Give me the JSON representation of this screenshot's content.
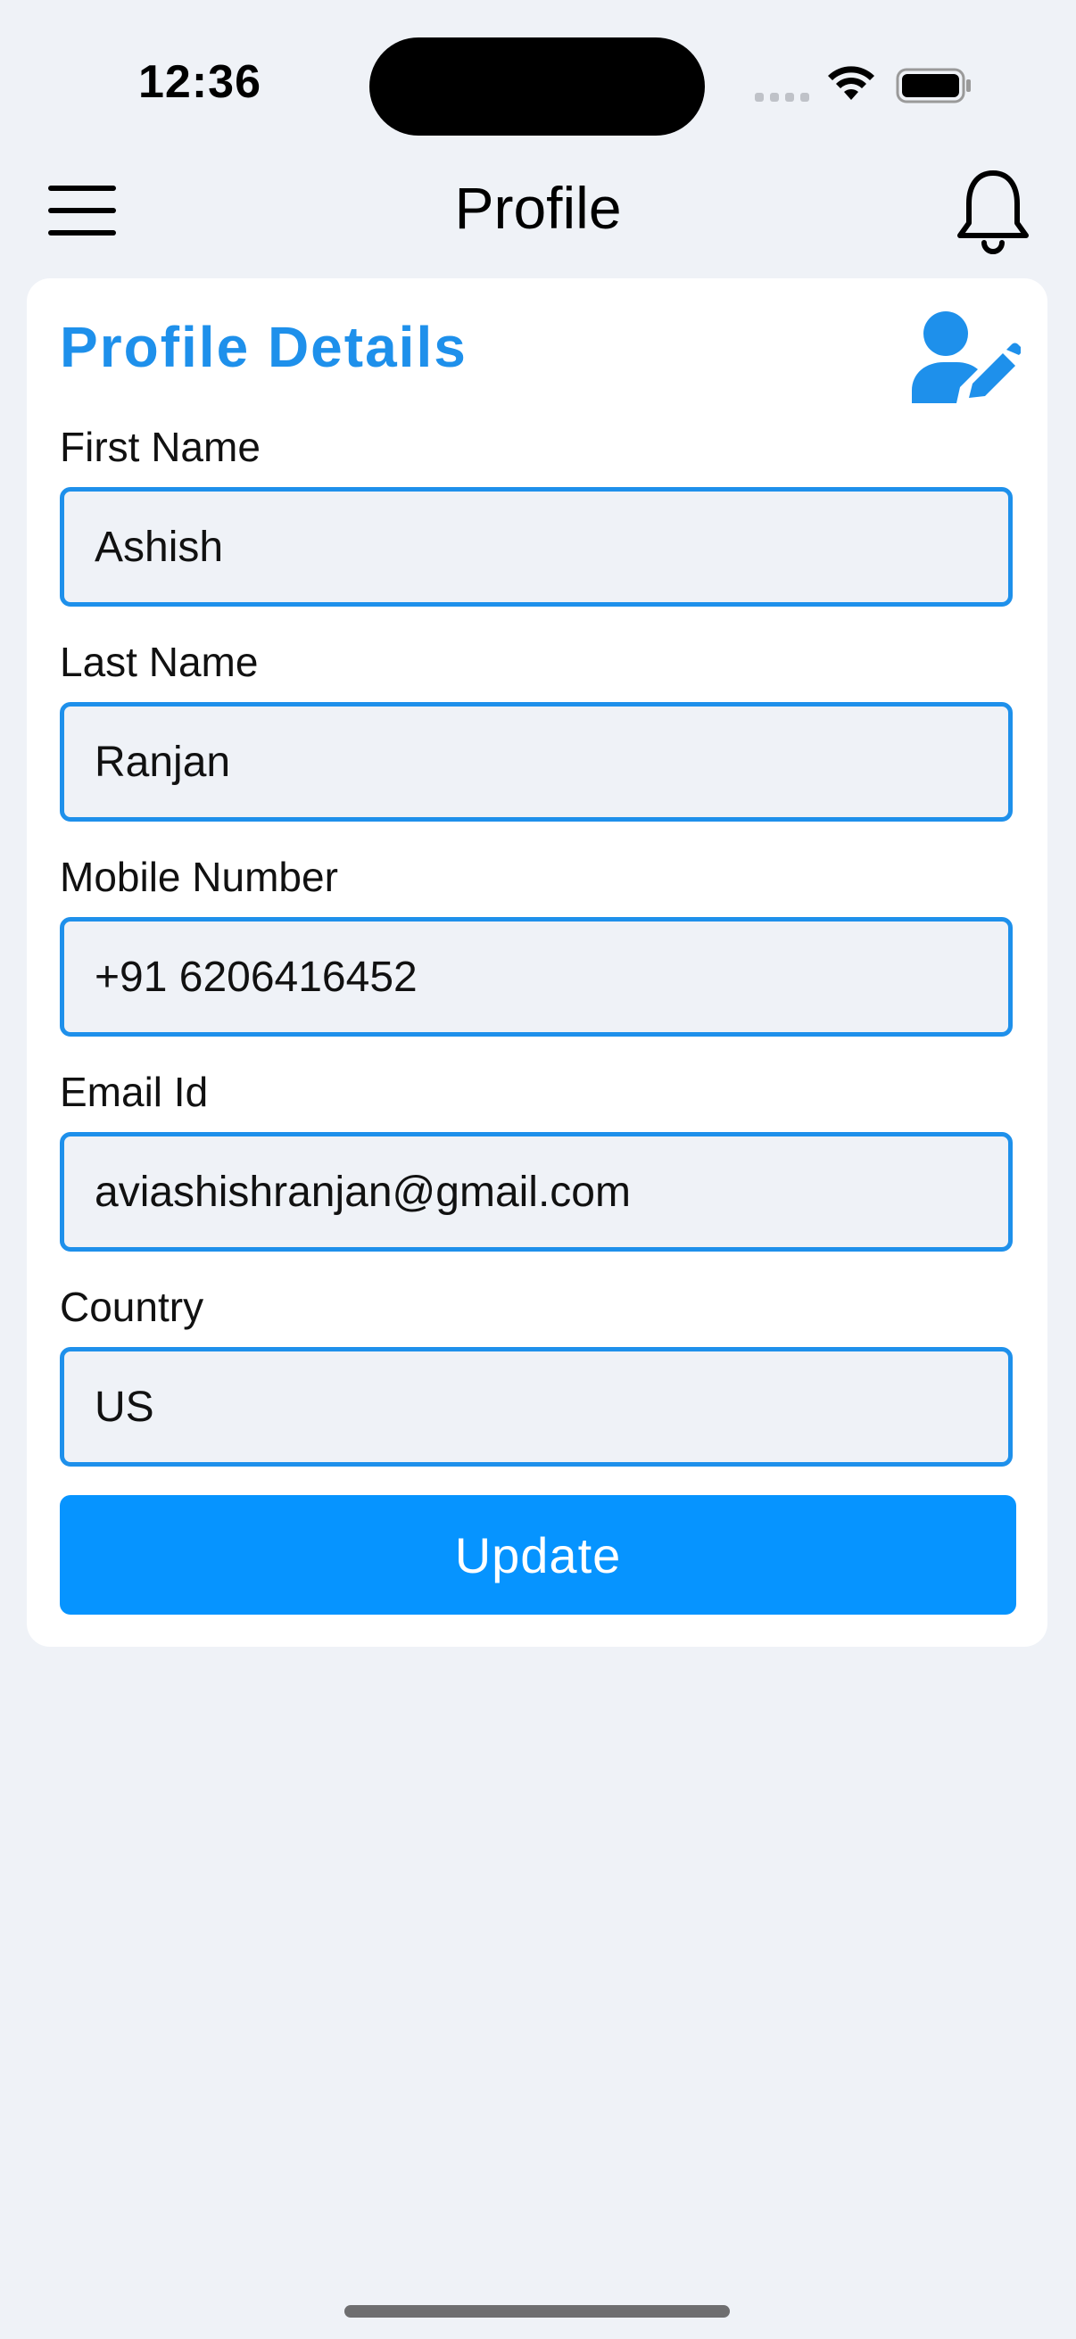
{
  "status_bar": {
    "time": "12:36",
    "icons": [
      "signal-dots-icon",
      "wifi-icon",
      "battery-icon"
    ]
  },
  "header": {
    "title": "Profile",
    "left_icon": "menu-icon",
    "right_icon": "bell-icon"
  },
  "card": {
    "title": "Profile Details",
    "title_icon": "edit-user-icon",
    "fields": [
      {
        "label": "First Name",
        "value": "Ashish"
      },
      {
        "label": "Last Name",
        "value": "Ranjan"
      },
      {
        "label": "Mobile Number",
        "value": "+91 6206416452"
      },
      {
        "label": "Email Id",
        "value": "aviashishranjan@gmail.com"
      },
      {
        "label": "Country",
        "value": "US"
      }
    ],
    "update_label": "Update"
  },
  "colors": {
    "accent": "#1E90EB",
    "button": "#0694FF",
    "background": "#EFF2F7",
    "card": "#FFFFFF"
  }
}
